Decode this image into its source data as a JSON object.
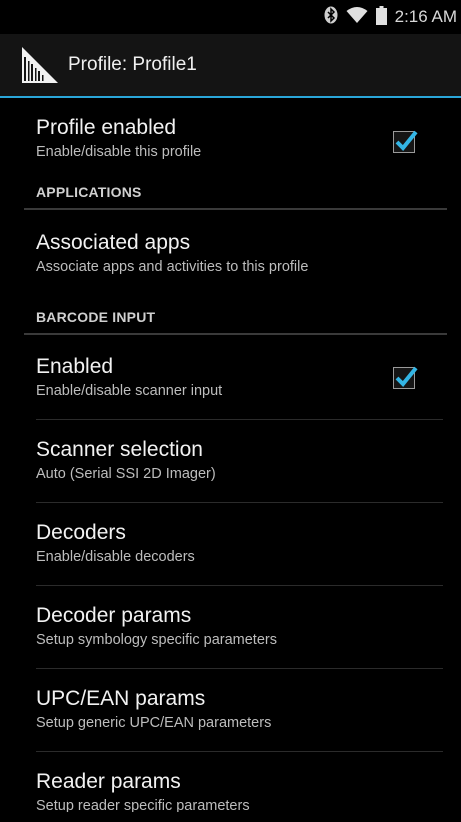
{
  "status_bar": {
    "time": "2:16 AM",
    "icons": [
      "bluetooth-icon",
      "wifi-icon",
      "battery-icon"
    ]
  },
  "action_bar": {
    "title": "Profile: Profile1",
    "icon": "barcode-app-icon"
  },
  "sections": {
    "profile": {
      "enabled_title": "Profile enabled",
      "enabled_summary": "Enable/disable this profile",
      "enabled_checked": true
    },
    "applications": {
      "header": "APPLICATIONS",
      "associated_title": "Associated apps",
      "associated_summary": "Associate apps and activities to this profile"
    },
    "barcode_input": {
      "header": "BARCODE INPUT",
      "enabled_title": "Enabled",
      "enabled_summary": "Enable/disable scanner input",
      "enabled_checked": true,
      "scanner_title": "Scanner selection",
      "scanner_summary": "Auto (Serial SSI 2D Imager)",
      "decoders_title": "Decoders",
      "decoders_summary": "Enable/disable decoders",
      "decoder_params_title": "Decoder params",
      "decoder_params_summary": "Setup symbology specific parameters",
      "upc_title": "UPC/EAN params",
      "upc_summary": "Setup generic UPC/EAN parameters",
      "reader_title": "Reader params",
      "reader_summary": "Setup reader specific parameters"
    }
  },
  "colors": {
    "accent": "#2aa6d9",
    "background": "#000000"
  }
}
